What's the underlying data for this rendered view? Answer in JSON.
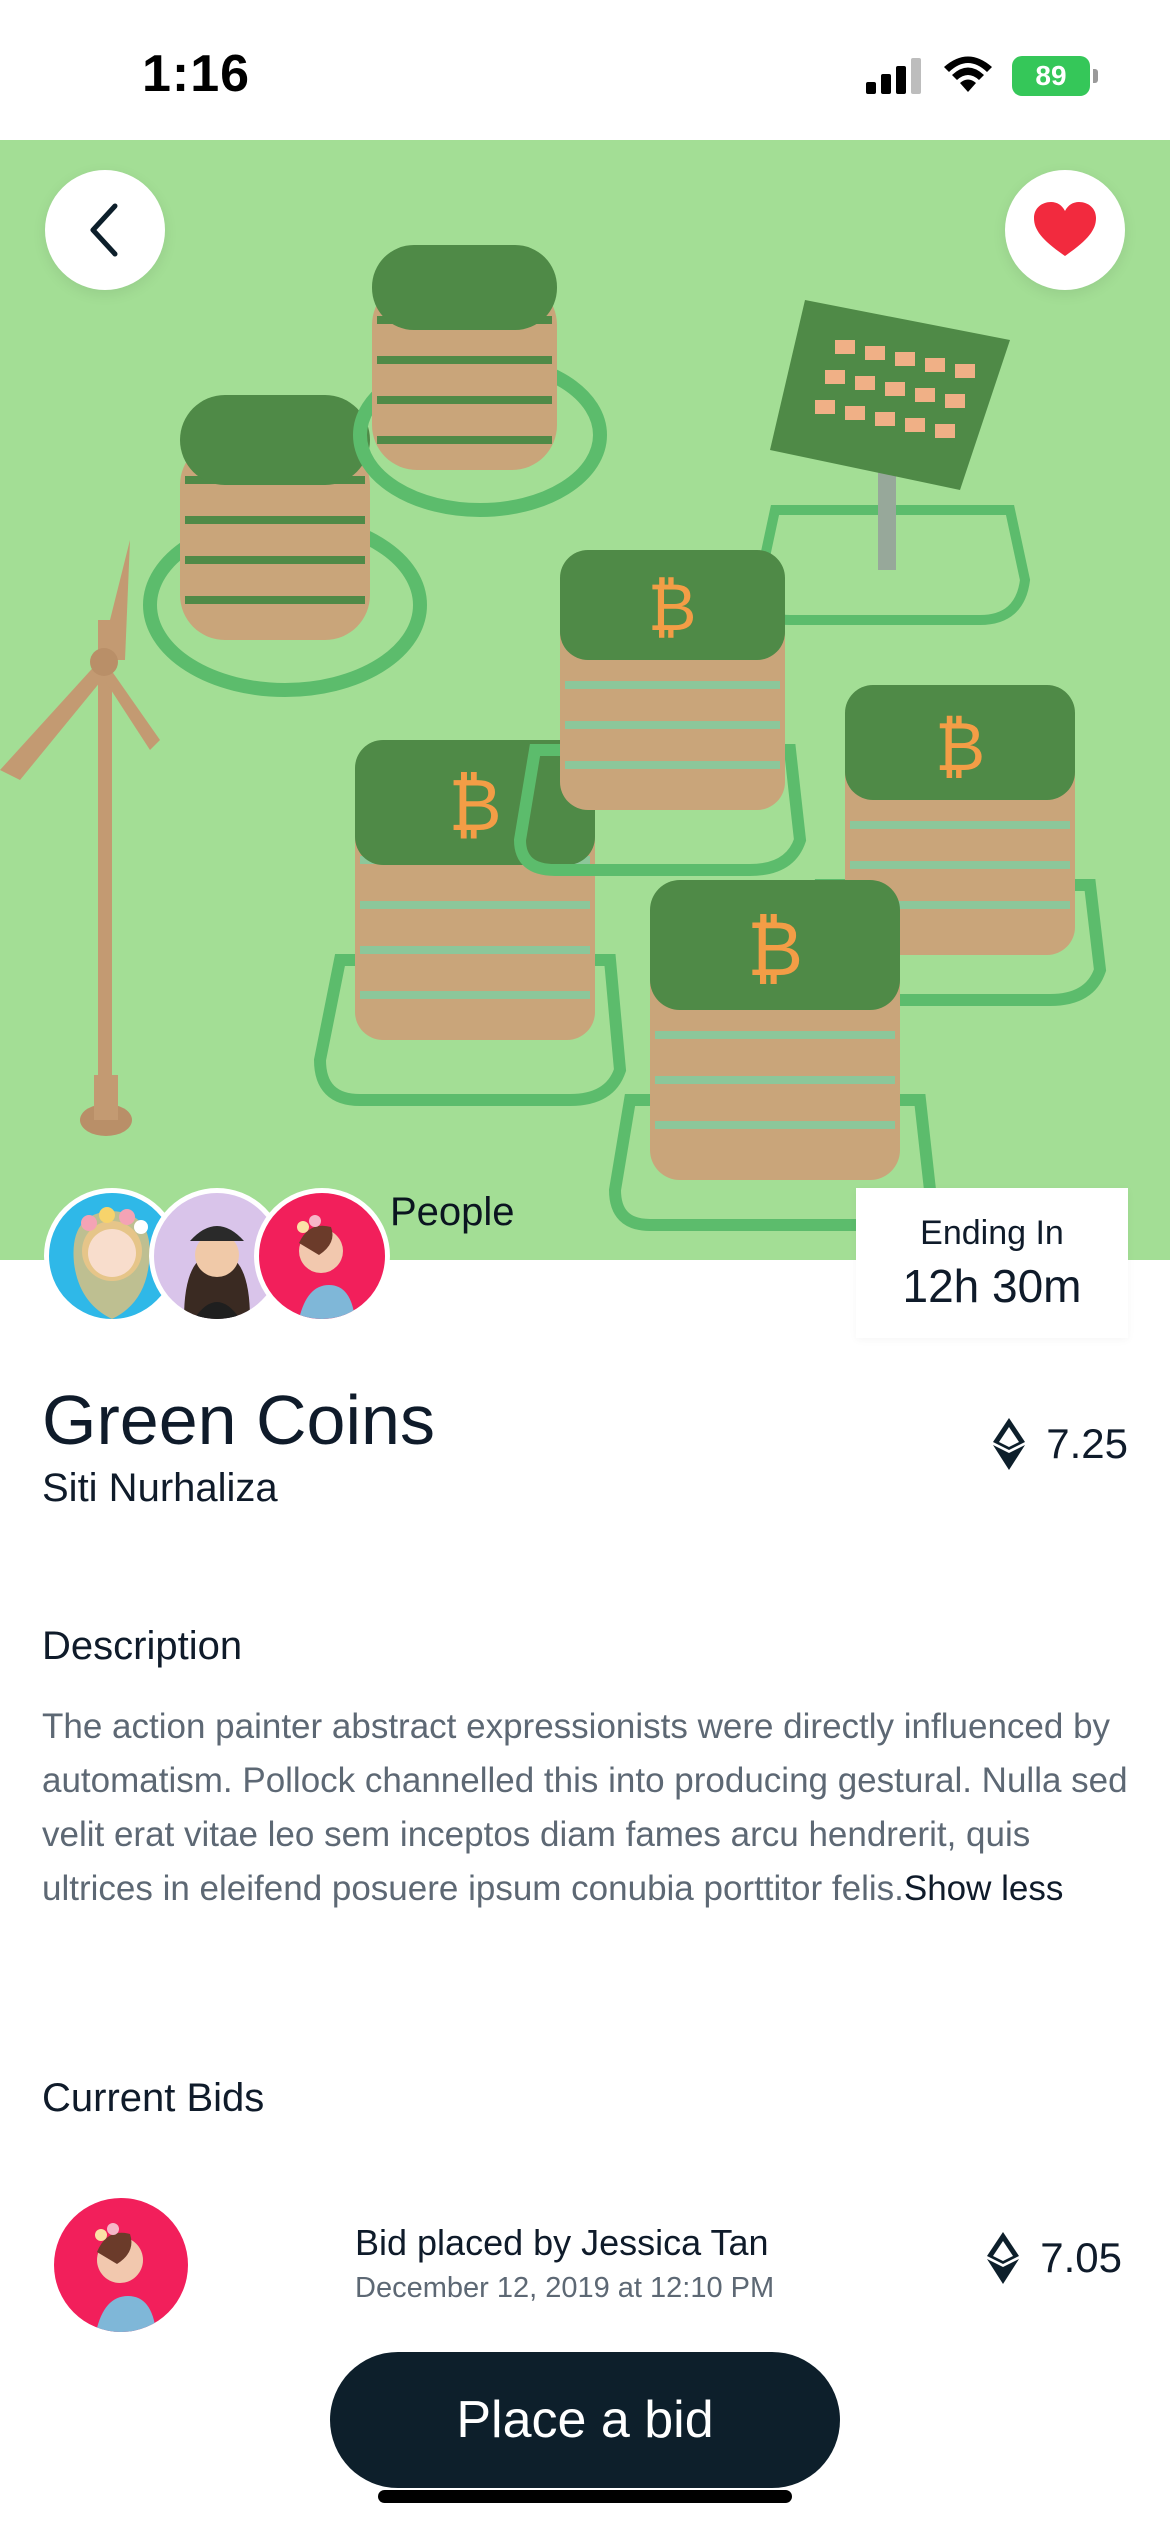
{
  "status_bar": {
    "time": "1:16",
    "battery": "89"
  },
  "hero": {
    "icons": {
      "back": "chevron-left-icon",
      "favorite": "heart-icon"
    },
    "favorite_color": "#f22a3e"
  },
  "people": {
    "label": "People",
    "avatars": [
      "avatar-flower-crown",
      "avatar-beanie",
      "avatar-profile-pink"
    ]
  },
  "auction": {
    "ending_label": "Ending In",
    "ending_value": "12h 30m"
  },
  "item": {
    "title": "Green Coins",
    "owner": "Siti Nurhaliza",
    "price": "7.25",
    "price_icon": "ethereum-icon"
  },
  "description": {
    "title": "Description",
    "text": "The action painter abstract expressionists were directly influenced by automatism. Pollock channelled this into producing gestural. Nulla sed velit erat vitae leo sem inceptos diam fames arcu hendrerit, quis ultrices in eleifend posuere ipsum conubia porttitor felis.",
    "toggle": "Show less"
  },
  "bids": {
    "title": "Current Bids",
    "items": [
      {
        "bidder_text": "Bid placed by Jessica Tan",
        "date": "December 12, 2019 at 12:10 PM",
        "amount": "7.05"
      }
    ]
  },
  "cta": {
    "label": "Place a bid"
  },
  "colors": {
    "hero_bg": "#a3de95",
    "button_bg": "#0d1f2b",
    "battery": "#35c759"
  }
}
